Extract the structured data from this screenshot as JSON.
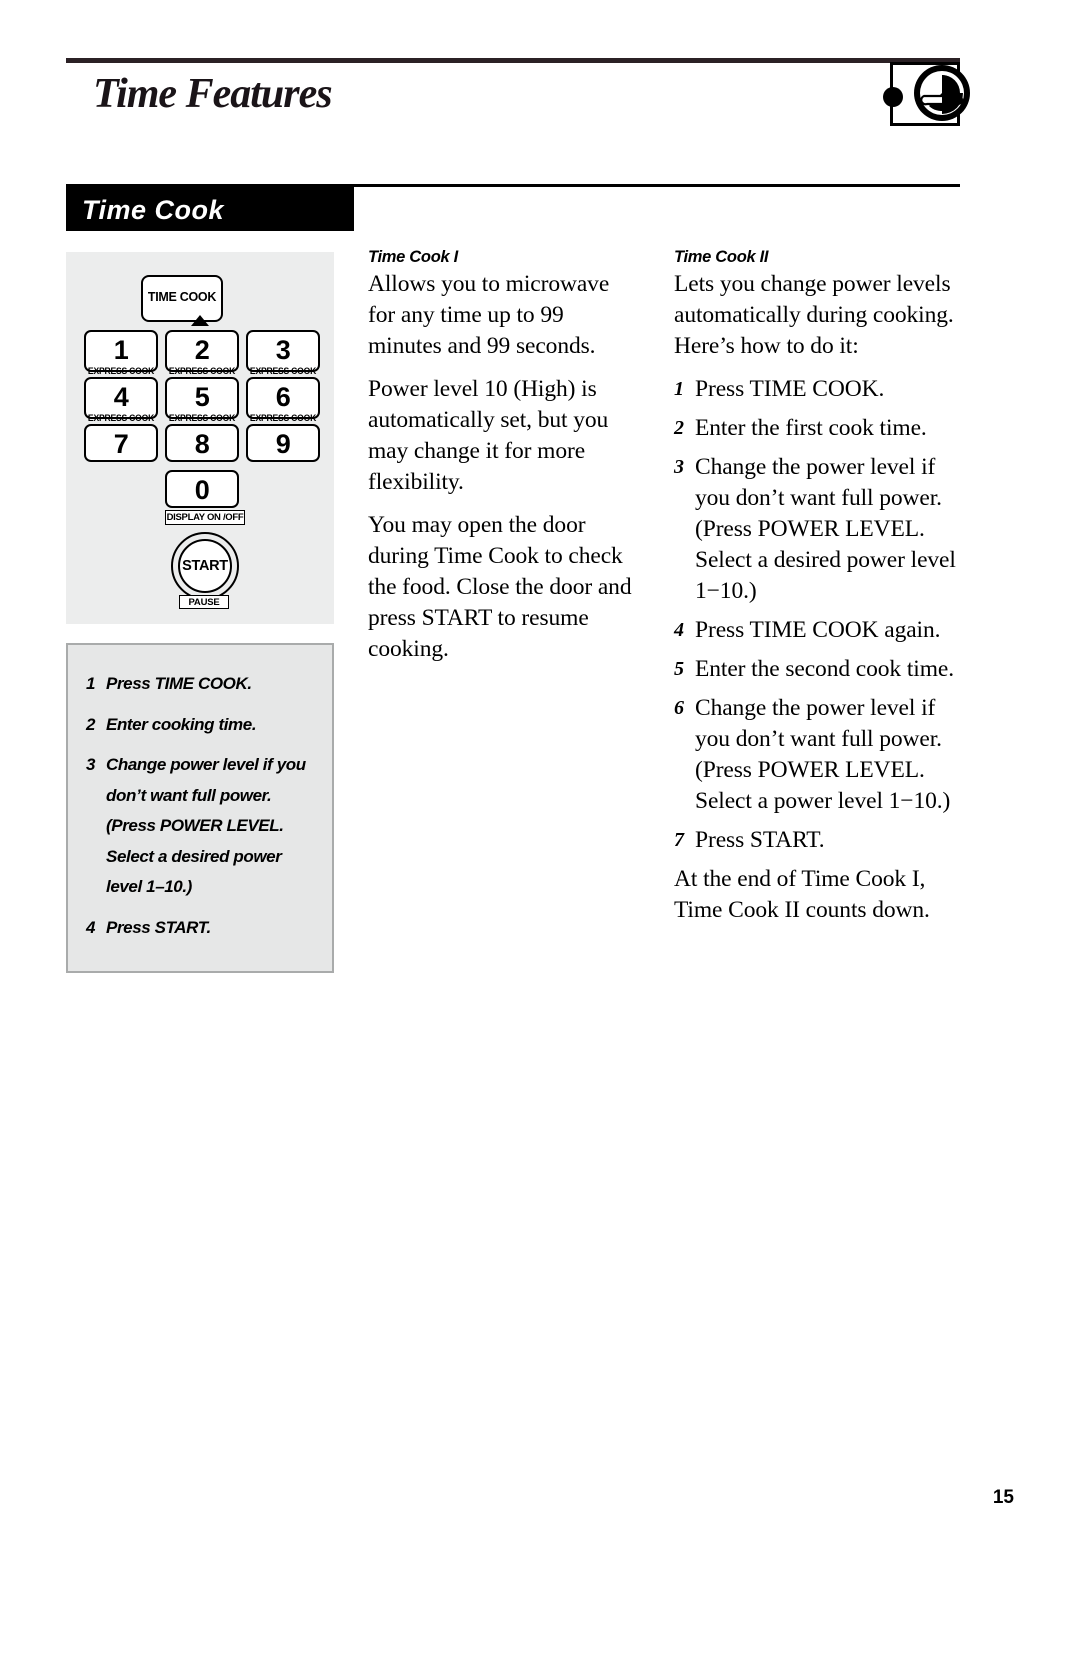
{
  "header": {
    "title": "Time Features",
    "logo_name": "ge-monogram-logo"
  },
  "section": {
    "title": "Time Cook"
  },
  "keypad": {
    "time_cook_label": "TIME COOK",
    "express_cook_sub": "EXPRESS COOK",
    "keys": [
      {
        "digit": "1",
        "sub": "EXPRESS COOK"
      },
      {
        "digit": "2",
        "sub": "EXPRESS COOK"
      },
      {
        "digit": "3",
        "sub": "EXPRESS COOK"
      },
      {
        "digit": "4",
        "sub": "EXPRESS COOK"
      },
      {
        "digit": "5",
        "sub": "EXPRESS COOK"
      },
      {
        "digit": "6",
        "sub": "EXPRESS COOK"
      },
      {
        "digit": "7",
        "sub": ""
      },
      {
        "digit": "8",
        "sub": ""
      },
      {
        "digit": "9",
        "sub": ""
      },
      {
        "digit": "0",
        "sub": ""
      }
    ],
    "display_label": "DISPLAY ON /OFF",
    "start_label": "START",
    "pause_label": "PAUSE"
  },
  "steps_box": {
    "items": [
      {
        "num": "1",
        "text": "Press TIME COOK."
      },
      {
        "num": "2",
        "text": "Enter cooking time."
      },
      {
        "num": "3",
        "text": "Change power level if you don’t want full power. (Press POWER LEVEL. Select a desired power level 1–10.)"
      },
      {
        "num": "4",
        "text": "Press START."
      }
    ]
  },
  "time_cook_1": {
    "heading": "Time Cook I",
    "p1": "Allows you to microwave for any time up to 99 minutes and 99 seconds.",
    "p2": "Power level 10 (High) is automatically set, but you may change it for more flexibility.",
    "p3": "You may open the door during Time Cook to check the food. Close the door and press START to resume cooking."
  },
  "time_cook_2": {
    "heading": "Time Cook II",
    "intro": "Lets you change power levels automatically during cooking. Here’s how to do it:",
    "steps": [
      {
        "num": "1",
        "text": "Press TIME COOK."
      },
      {
        "num": "2",
        "text": "Enter the first cook time."
      },
      {
        "num": "3",
        "text": "Change the power level if you don’t want full power. (Press POWER LEVEL. Select a desired power level 1−10.)"
      },
      {
        "num": "4",
        "text": "Press TIME COOK again."
      },
      {
        "num": "5",
        "text": "Enter the second cook time."
      },
      {
        "num": "6",
        "text": "Change the power level if you don’t want full power. (Press POWER LEVEL. Select a power level 1−10.)"
      },
      {
        "num": "7",
        "text": "Press START."
      }
    ],
    "closing": "At the end of Time Cook I, Time Cook II counts down."
  },
  "footer": {
    "page_number": "15"
  }
}
